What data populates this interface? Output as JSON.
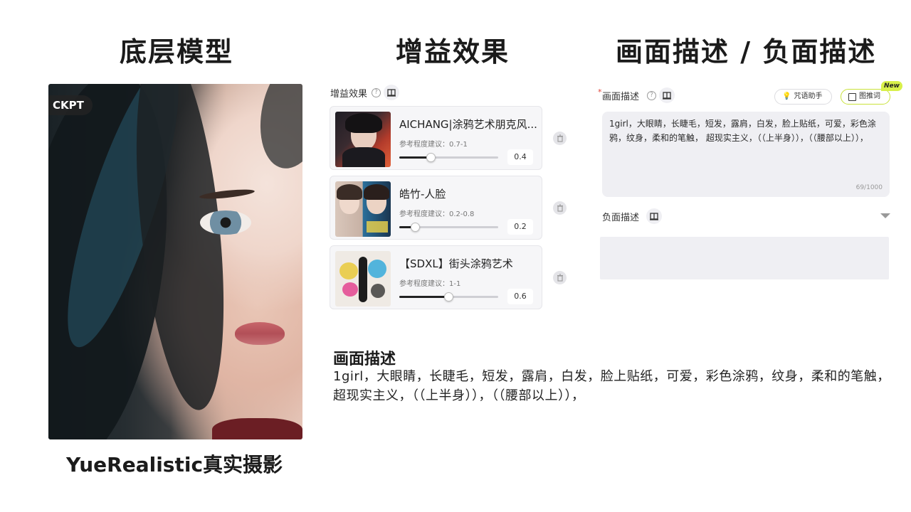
{
  "headings": {
    "base_model": "底层模型",
    "gain_effect": "增益效果",
    "prompt_negative": "画面描述 / 负面描述"
  },
  "base_model": {
    "badge": "CKPT",
    "caption": "YueRealistic真实摄影"
  },
  "gain_panel": {
    "label": "增益效果",
    "help_icon": "question-circle-icon",
    "library_icon": "book-icon",
    "items": [
      {
        "title": "AICHANG|涂鸦艺术朋克风...",
        "hint": "参考程度建议：0.7-1",
        "value": "0.4",
        "level": 0.32
      },
      {
        "title": "皓竹-人脸",
        "hint": "参考程度建议：0.2-0.8",
        "value": "0.2",
        "level": 0.16
      },
      {
        "title": "【SDXL】街头涂鸦艺术",
        "hint": "参考程度建议：1-1",
        "value": "0.6",
        "level": 0.5
      }
    ]
  },
  "prompt_panel": {
    "required_mark": "*",
    "label": "画面描述",
    "assistant_button": "咒语助手",
    "image_to_prompt_button": "图推词",
    "new_badge": "New",
    "prompt_text": "1girl，大眼睛，长睫毛，短发，露肩，白发，脸上贴纸，可爱，彩色涂鸦，纹身，柔和的笔触， 超现实主义，（（上半身）），（（腰部以上）），",
    "counter": "69/1000",
    "negative_label": "负面描述",
    "negative_text": ""
  },
  "bottom_description": {
    "title": "画面描述",
    "text": "1girl，大眼睛，长睫毛，短发，露肩，白发，脸上贴纸，可爱，彩色涂鸦，纹身，柔和的笔触， 超现实主义，（（上半身）），（（腰部以上）），"
  }
}
